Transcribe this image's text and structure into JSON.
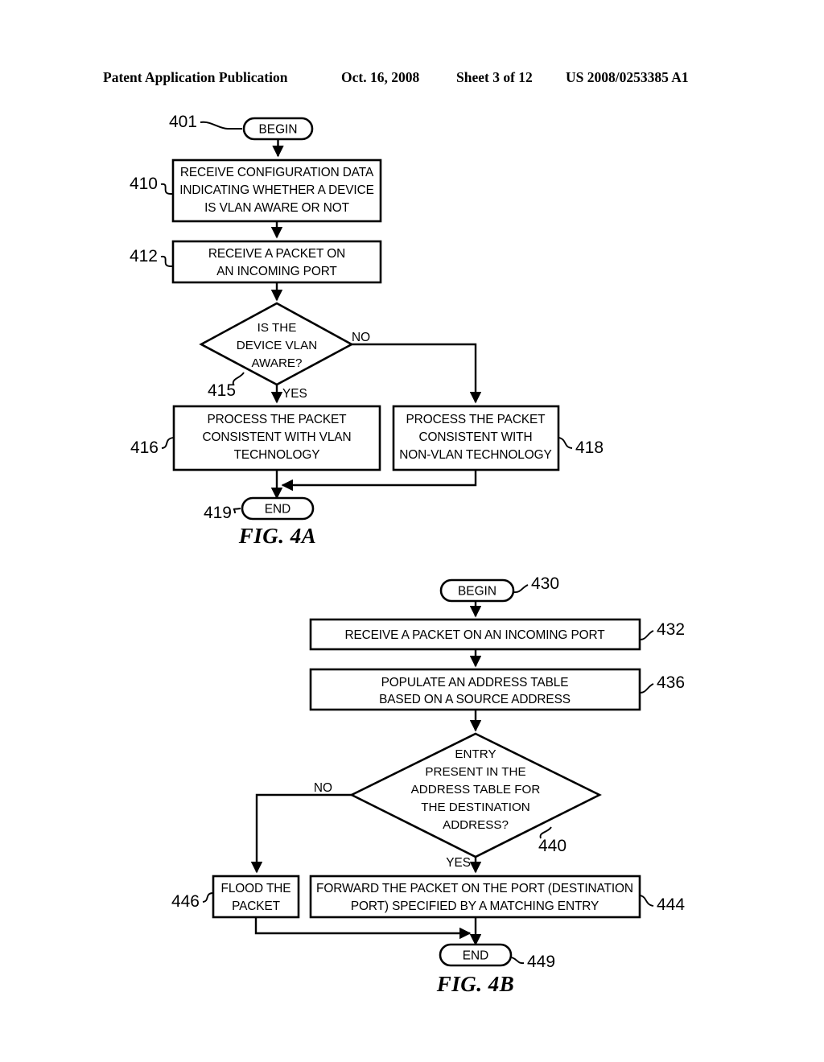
{
  "header": {
    "publication": "Patent Application Publication",
    "date": "Oct. 16, 2008",
    "sheet": "Sheet 3 of 12",
    "patent_number": "US 2008/0253385 A1"
  },
  "figures": [
    {
      "id": "fig-4a",
      "caption": "FIG. 4A",
      "nodes": {
        "begin": {
          "ref": "401",
          "label": "BEGIN"
        },
        "s410": {
          "ref": "410",
          "lines": [
            "RECEIVE CONFIGURATION DATA",
            "INDICATING WHETHER A DEVICE",
            "IS VLAN AWARE OR NOT"
          ]
        },
        "s412": {
          "ref": "412",
          "lines": [
            "RECEIVE A PACKET ON",
            "AN INCOMING PORT"
          ]
        },
        "d415": {
          "ref": "415",
          "lines": [
            "IS THE",
            "DEVICE VLAN",
            "AWARE?"
          ],
          "branch_yes": "YES",
          "branch_no": "NO"
        },
        "s416": {
          "ref": "416",
          "lines": [
            "PROCESS THE PACKET",
            "CONSISTENT WITH VLAN",
            "TECHNOLOGY"
          ]
        },
        "s418": {
          "ref": "418",
          "lines": [
            "PROCESS THE PACKET",
            "CONSISTENT WITH",
            "NON-VLAN TECHNOLOGY"
          ]
        },
        "end": {
          "ref": "419",
          "label": "END"
        }
      }
    },
    {
      "id": "fig-4b",
      "caption": "FIG. 4B",
      "nodes": {
        "begin": {
          "ref": "430",
          "label": "BEGIN"
        },
        "s432": {
          "ref": "432",
          "lines": [
            "RECEIVE A PACKET ON AN INCOMING PORT"
          ]
        },
        "s436": {
          "ref": "436",
          "lines": [
            "POPULATE AN ADDRESS TABLE",
            "BASED ON A SOURCE ADDRESS"
          ]
        },
        "d440": {
          "ref": "440",
          "lines": [
            "ENTRY",
            "PRESENT IN THE",
            "ADDRESS TABLE FOR",
            "THE DESTINATION",
            "ADDRESS?"
          ],
          "branch_yes": "YES",
          "branch_no": "NO"
        },
        "s444": {
          "ref": "444",
          "lines": [
            "FORWARD THE PACKET ON THE PORT (DESTINATION",
            "PORT) SPECIFIED BY A MATCHING ENTRY"
          ]
        },
        "s446": {
          "ref": "446",
          "lines": [
            "FLOOD THE",
            "PACKET"
          ]
        },
        "end": {
          "ref": "449",
          "label": "END"
        }
      }
    }
  ]
}
